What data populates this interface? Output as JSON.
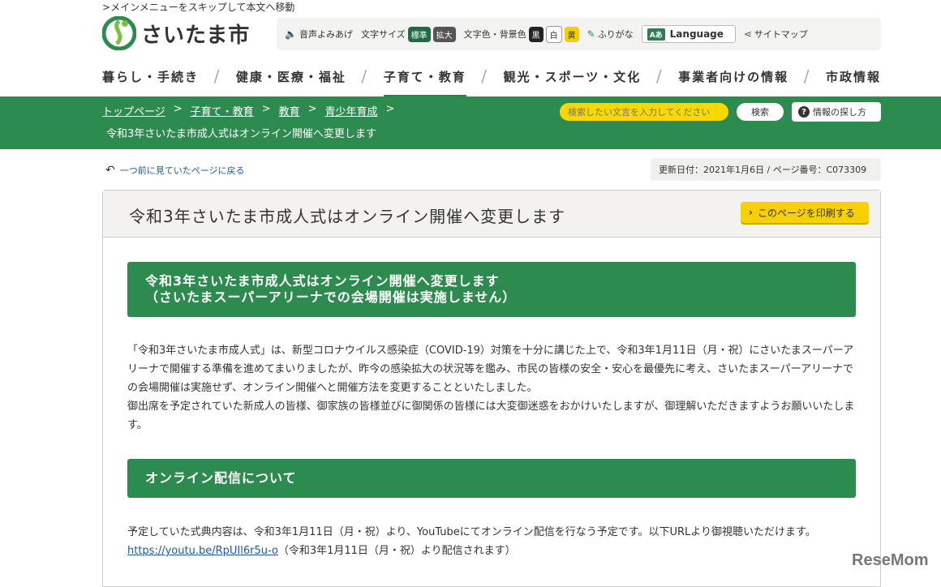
{
  "skip_link": "メインメニューをスキップして本文へ移動",
  "site": {
    "name": "さいたま市"
  },
  "utility": {
    "voice": "音声よみあげ",
    "text_size_label": "文字サイズ",
    "size_standard": "標準",
    "size_large": "拡大",
    "color_label": "文字色・背景色",
    "color_black": "黒",
    "color_white": "白",
    "color_yellow": "黄",
    "furigana": "ふりがな",
    "language": "Language",
    "language_icon": "Aあ",
    "sitemap": "サイトマップ"
  },
  "global_nav": [
    "暮らし・手続き",
    "健康・医療・福祉",
    "子育て・教育",
    "観光・スポーツ・文化",
    "事業者向けの情報",
    "市政情報"
  ],
  "breadcrumb": {
    "items": [
      "トップページ",
      "子育て・教育",
      "教育",
      "青少年育成"
    ],
    "current": "令和3年さいたま市成人式はオンライン開催へ変更します"
  },
  "search": {
    "placeholder": "検索したい文言を入力してください",
    "button": "検索",
    "howto": "情報の探し方"
  },
  "back_link": "一つ前に見ていたページに戻る",
  "updated": "更新日付：2021年1月6日 / ページ番号：C073309",
  "page": {
    "title": "令和3年さいたま市成人式はオンライン開催へ変更します",
    "print": "このページを印刷する",
    "heading1_line1": "令和3年さいたま市成人式はオンライン開催へ変更します",
    "heading1_line2": "（さいたまスーパーアリーナでの会場開催は実施しません）",
    "para1": "「令和3年さいたま市成人式」は、新型コロナウイルス感染症（COVID-19）対策を十分に講じた上で、令和3年1月11日（月・祝）にさいたまスーパーアリーナで開催する準備を進めてまいりましたが、昨今の感染拡大の状況等を鑑み、市民の皆様の安全・安心を最優先に考え、さいたまスーパーアリーナでの会場開催は実施せず、オンライン開催へと開催方法を変更することといたしました。",
    "para2": "御出席を予定されていた新成人の皆様、御家族の皆様並びに御関係の皆様には大変御迷惑をおかけいたしますが、御理解いただきますようお願いいたします。",
    "heading2": "オンライン配信について",
    "para3": "予定していた式典内容は、令和3年1月11日（月・祝）より、YouTubeにてオンライン配信を行なう予定です。以下URLより御視聴いただけます。",
    "url": "https://youtu.be/RpUIl6r5u-o",
    "url_note": "（令和3年1月11日（月・祝）より配信されます）"
  },
  "watermark": "ReseMom"
}
